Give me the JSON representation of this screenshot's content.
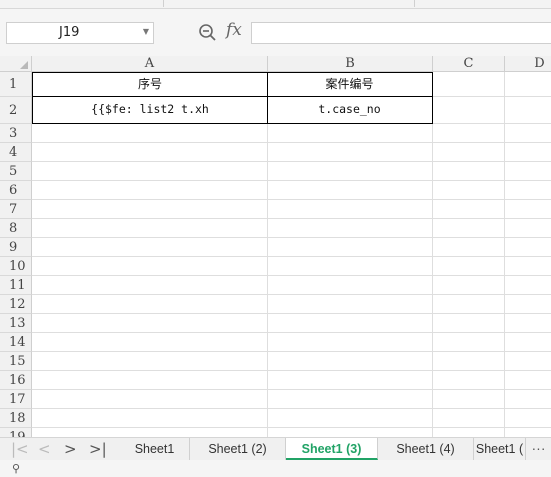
{
  "formula_bar": {
    "name_box": "J19",
    "fx_label": "fx",
    "formula_value": ""
  },
  "columns": [
    "A",
    "B",
    "C",
    "D"
  ],
  "rows": [
    "1",
    "2",
    "3",
    "4",
    "5",
    "6",
    "7",
    "8",
    "9",
    "10",
    "11",
    "12",
    "13",
    "14",
    "15",
    "16",
    "17",
    "18",
    "19"
  ],
  "table": {
    "headers": [
      "序号",
      "案件编号"
    ],
    "row2": [
      "{{$fe: list2 t.xh",
      "t.case_no"
    ]
  },
  "sheet_tabs": {
    "items": [
      "Sheet1",
      "Sheet1 (2)",
      "Sheet1 (3)",
      "Sheet1 (4)",
      "Sheet1 ("
    ],
    "active_index": 2,
    "more_label": "···"
  },
  "colors": {
    "accent": "#21a366"
  }
}
